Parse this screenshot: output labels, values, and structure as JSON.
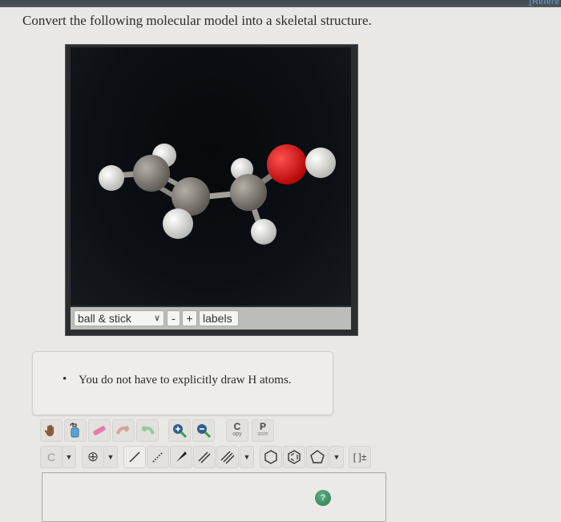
{
  "header": {
    "reference_link": "[Refere"
  },
  "question": {
    "text": "Convert the following molecular model into a skeletal structure."
  },
  "viewer": {
    "model": {
      "atoms": [
        {
          "element": "C",
          "color": "#8c8780"
        },
        {
          "element": "C",
          "color": "#8c8780"
        },
        {
          "element": "C",
          "color": "#8c8780"
        },
        {
          "element": "O",
          "color": "#e01616"
        },
        {
          "element": "H",
          "color": "#e8e8e4"
        }
      ]
    },
    "controls": {
      "style_select": "ball & stick",
      "zoom_out_label": "-",
      "zoom_in_label": "+",
      "labels_button": "labels"
    }
  },
  "hint": {
    "bullet": "•",
    "text": "You do not have to explicitly draw H atoms."
  },
  "editor": {
    "toolbar_top": [
      {
        "name": "hand-icon",
        "label": ""
      },
      {
        "name": "erase-all-icon",
        "label": ""
      },
      {
        "name": "eraser-icon",
        "label": ""
      },
      {
        "name": "undo-icon",
        "label": ""
      },
      {
        "name": "redo-icon",
        "label": ""
      },
      {
        "name": "zoom-in-icon",
        "label": ""
      },
      {
        "name": "zoom-out-icon",
        "label": ""
      },
      {
        "name": "copy-button",
        "label_big": "C",
        "label_small": "opy"
      },
      {
        "name": "paste-button",
        "label_big": "P",
        "label_small": "aste"
      }
    ],
    "toolbar_bottom": {
      "atom_label": "C",
      "charge_label": "⊕",
      "bracket_label": "[ ]±"
    },
    "help_label": "?"
  }
}
